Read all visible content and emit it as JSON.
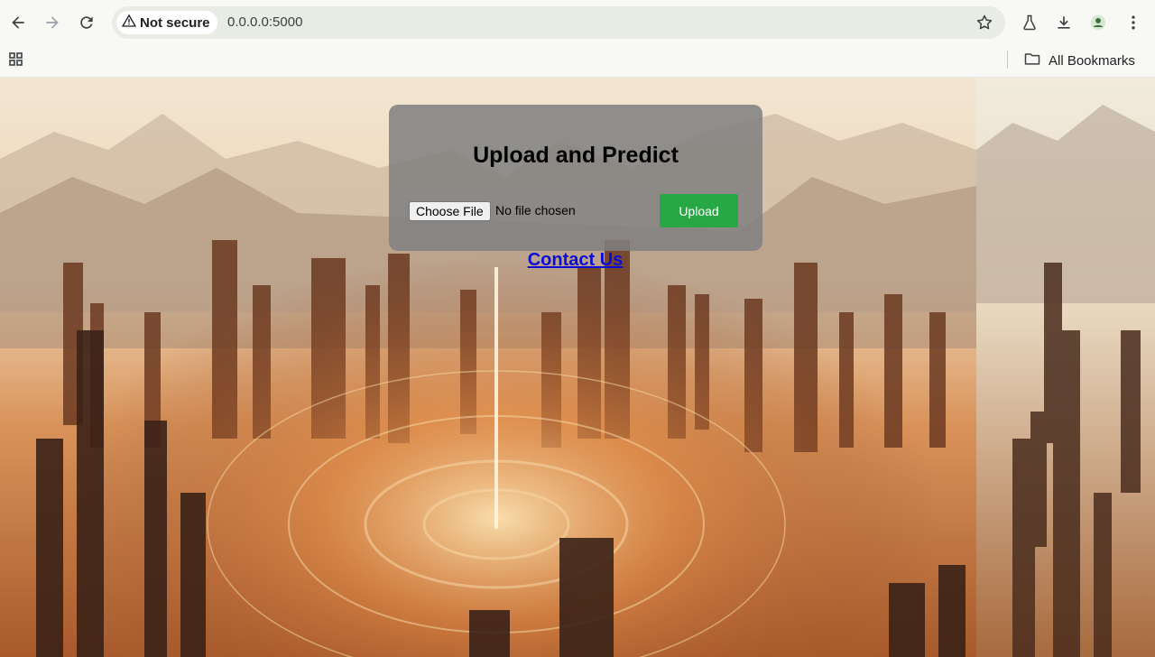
{
  "browser": {
    "security_label": "Not secure",
    "url": "0.0.0.0:5000",
    "bookmarks_label": "All Bookmarks"
  },
  "page": {
    "heading": "Upload and Predict",
    "file_button_label": "Choose File",
    "file_status": "No file chosen",
    "upload_button_label": "Upload",
    "contact_link_label": "Contact Us"
  },
  "icons": [
    "back-icon",
    "forward-icon",
    "reload-icon",
    "warning-icon",
    "star-icon",
    "labs-icon",
    "download-icon",
    "profile-icon",
    "menu-icon",
    "apps-icon",
    "folder-icon"
  ],
  "colors": {
    "upload_button": "#28a745",
    "link": "#0b0bd6"
  }
}
